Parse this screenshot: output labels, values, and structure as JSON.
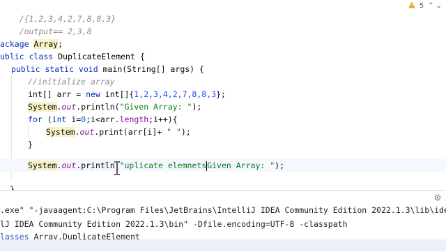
{
  "editor": {
    "lines": {
      "l1": "/{1,2,3,4,2,7,8,8,3}",
      "l2": "/output== 2,3,8",
      "l3_kw": "ackage",
      "l3_pkg": "Array",
      "l4_kw1": "ublic",
      "l4_kw2": "class",
      "l4_name": "DuplicateElement",
      "l5_kw": "public static void",
      "l5_rest": "main(String[] args) {",
      "l6_cmt": "//initialize array",
      "l7_a": "int[] arr = ",
      "l7_kw": "new",
      "l7_b": " int[]{",
      "l7_nums": "1,2,3,4,2,7,8,8,3",
      "l7_c": "};",
      "l8_sys": "System",
      "l8_out": "out",
      "l8_call": ".println(",
      "l8_str": "\"Given Array: \"",
      "l8_end": ");",
      "l9_for": "for",
      "l9_a": " (",
      "l9_int": "int",
      "l9_b": " i=",
      "l9_zero": "0",
      "l9_c": ";i<arr.",
      "l9_len": "length",
      "l9_d": ";i++){",
      "l10_sys": "System",
      "l10_out": "out",
      "l10_call": ".print(arr[i]+ ",
      "l10_str": "\" \"",
      "l10_end": ");",
      "l11": "}",
      "l13_sys": "System",
      "l13_out": "out",
      "l13_call": ".println(",
      "l13_str1": "\"uplicate elemnets",
      "l13_str2": "Given Array: \"",
      "l13_end": ");",
      "l15": "}"
    },
    "inspection": {
      "warnings": "5",
      "warning_icon": "warning-triangle-icon",
      "nav": "⌃ ⌄"
    }
  },
  "run_panel": {
    "line1": ".exe\" \"-javaagent:C:\\Program Files\\JetBrains\\IntelliJ IDEA Community Edition 2022.1.3\\lib\\idea_rt",
    "line2": "lJ IDEA Community Edition 2022.1.3\\bin\" -Dfile.encoding=UTF-8 -classpath",
    "line3_link": "lasses",
    "line3_rest": " Array.DuplicateElement",
    "settings_icon": "gear-icon"
  },
  "colors": {
    "keyword": "#0033b3",
    "string": "#067d17",
    "number": "#1750eb",
    "comment": "#8c8c8c",
    "field": "#871094",
    "status_bar": "#e9f0fb"
  }
}
